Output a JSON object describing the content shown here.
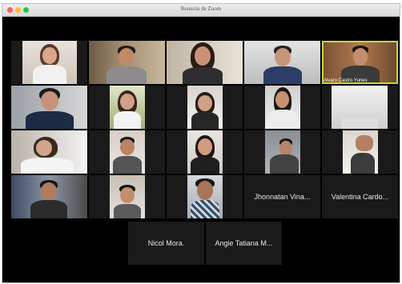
{
  "window": {
    "title": "Reunión de Zoom"
  },
  "active_speaker": "Alvaro Castro Yunes",
  "participants": [
    {
      "label": ""
    },
    {
      "label": ""
    },
    {
      "label": ""
    },
    {
      "label": ""
    },
    {
      "label": "Alvaro Castro Yunes"
    },
    {
      "label": ""
    },
    {
      "label": ""
    },
    {
      "label": ""
    },
    {
      "label": ""
    },
    {
      "label": ""
    },
    {
      "label": ""
    },
    {
      "label": ""
    },
    {
      "label": ""
    },
    {
      "label": ""
    },
    {
      "label": ""
    },
    {
      "label": ""
    },
    {
      "label": ""
    },
    {
      "label": ""
    },
    {
      "label": "Jhonnatan Vina..."
    },
    {
      "label": "Valentina Cardo..."
    },
    {
      "label": "Nicol Mora."
    },
    {
      "label": "Angie Tatiana M..."
    }
  ]
}
